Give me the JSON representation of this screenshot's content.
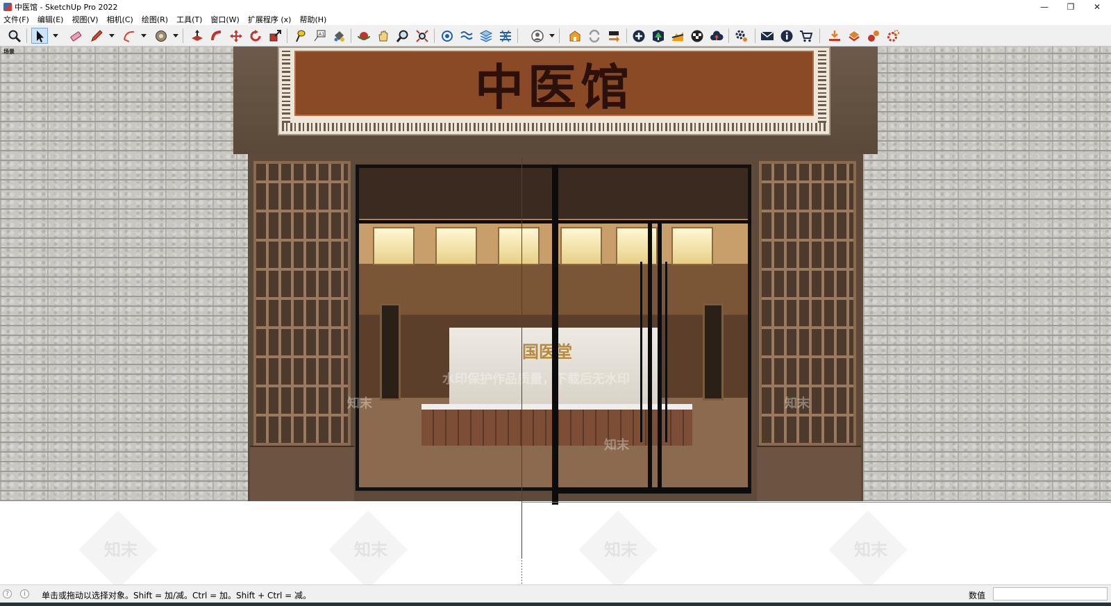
{
  "window": {
    "title": "中医馆 - SketchUp Pro 2022",
    "controls": [
      "—",
      "❐",
      "✕"
    ]
  },
  "menu": {
    "items": [
      "文件(F)",
      "编辑(E)",
      "视图(V)",
      "相机(C)",
      "绘图(R)",
      "工具(T)",
      "窗口(W)",
      "扩展程序 (x)",
      "帮助(H)"
    ]
  },
  "toolbar": {
    "tools": [
      "zoom-window-icon",
      "select-icon",
      "eraser-icon",
      "pencil-icon",
      "arc-icon",
      "tape-measure-icon",
      "push-pull-icon",
      "follow-me-icon",
      "move-icon",
      "rotate-icon",
      "scale-icon",
      "position-camera-icon",
      "text-icon",
      "paint-bucket-icon",
      "orbit-icon",
      "pan-icon",
      "zoom-icon",
      "zoom-extents-icon",
      "component-icon",
      "section-plane-icon",
      "layers-icon",
      "styles-icon",
      "account-icon",
      "warehouse-icon",
      "sync-icon",
      "send-icon",
      "add-icon",
      "tree-icon",
      "sandbox-icon",
      "checker-icon",
      "cloud-upload-icon",
      "settings-icon",
      "mail-icon",
      "info-icon",
      "cart-icon",
      "extension-down-icon",
      "extension-shield-icon",
      "extension-tools-icon",
      "extension-gear-icon"
    ]
  },
  "scene": {
    "label": "场景",
    "sign_text": "中医馆",
    "reception_title": "国医堂",
    "watermark_text": "知末",
    "watermark_notice": "水印保护作品质量，下载后无水印"
  },
  "status": {
    "hint": "单击或拖动以选择对象。Shift = 加/减。Ctrl = 加。Shift + Ctrl = 减。",
    "measure_label": "数值",
    "measure_value": ""
  },
  "colors": {
    "toolbar_bg": "#f0f0f0",
    "sign_board": "#8b4a26",
    "door_frame": "#111111",
    "axis_blue": "#3535b0"
  }
}
